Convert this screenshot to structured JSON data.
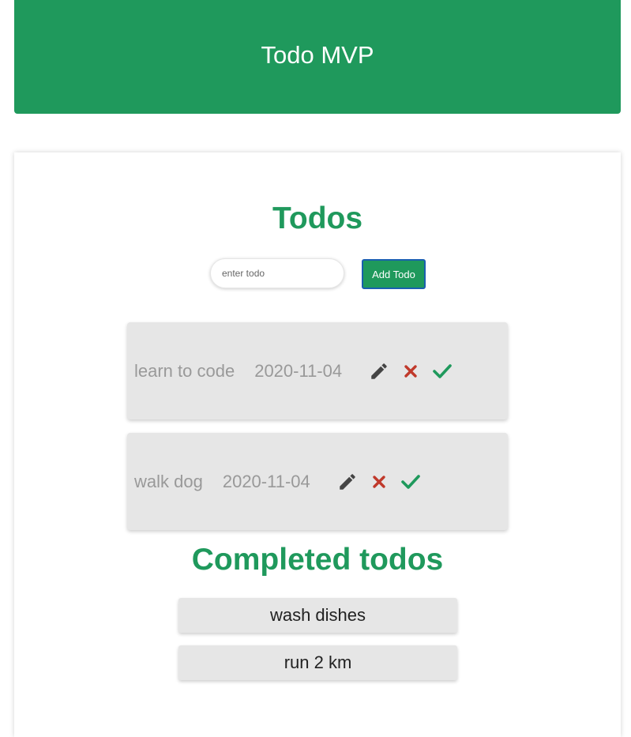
{
  "header": {
    "title": "Todo MVP"
  },
  "todos_section": {
    "title": "Todos",
    "input_placeholder": "enter todo",
    "add_button_label": "Add Todo",
    "items": [
      {
        "text": "learn to code",
        "date": "2020-11-04"
      },
      {
        "text": "walk dog",
        "date": "2020-11-04"
      }
    ]
  },
  "completed_section": {
    "title": "Completed todos",
    "items": [
      {
        "text": "wash dishes"
      },
      {
        "text": "run 2 km"
      }
    ]
  },
  "icons": {
    "edit": "pencil-icon",
    "delete": "close-icon",
    "complete": "checkmark-icon"
  },
  "colors": {
    "accent": "#1f995c",
    "delete": "#c0392b",
    "edit": "#444444",
    "item_bg": "#e6e6e6"
  }
}
